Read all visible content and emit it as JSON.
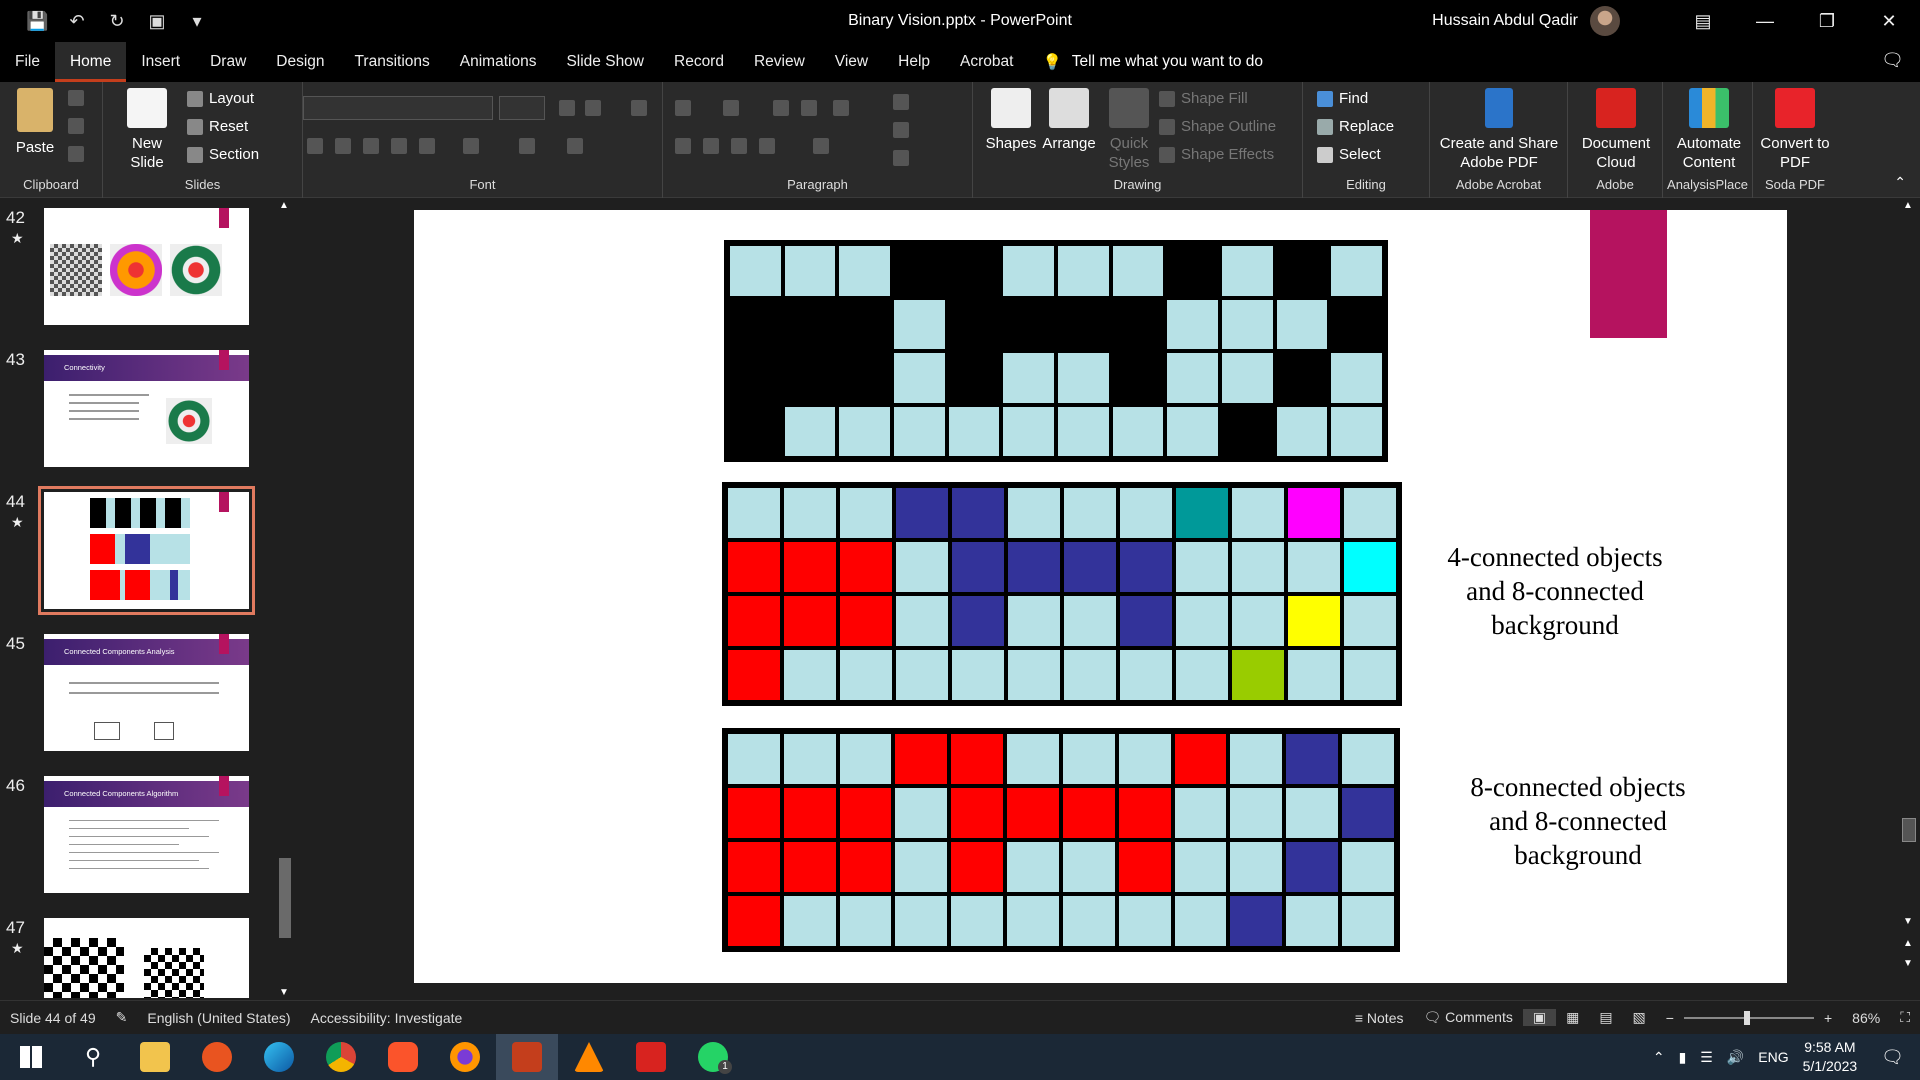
{
  "window": {
    "title": "Binary Vision.pptx  -  PowerPoint",
    "user": "Hussain Abdul Qadir"
  },
  "tabs": [
    "File",
    "Home",
    "Insert",
    "Draw",
    "Design",
    "Transitions",
    "Animations",
    "Slide Show",
    "Record",
    "Review",
    "View",
    "Help",
    "Acrobat"
  ],
  "tellme": "Tell me what you want to do",
  "ribbon": {
    "clipboard": {
      "paste": "Paste",
      "label": "Clipboard"
    },
    "slides": {
      "new_slide": "New Slide",
      "layout": "Layout",
      "reset": "Reset",
      "section": "Section",
      "label": "Slides"
    },
    "font": {
      "label": "Font"
    },
    "paragraph": {
      "label": "Paragraph"
    },
    "drawing": {
      "shapes": "Shapes",
      "arrange": "Arrange",
      "quick_styles": "Quick Styles",
      "shape_fill": "Shape Fill",
      "shape_outline": "Shape Outline",
      "shape_effects": "Shape Effects",
      "label": "Drawing"
    },
    "editing": {
      "find": "Find",
      "replace": "Replace",
      "select": "Select",
      "label": "Editing"
    },
    "acrobat": {
      "create": "Create and Share Adobe PDF",
      "label": "Adobe Acrobat"
    },
    "adobe": {
      "doc_cloud": "Document Cloud",
      "label": "Adobe"
    },
    "analysis": {
      "automate": "Automate Content",
      "label": "AnalysisPlace"
    },
    "soda": {
      "convert": "Convert to PDF",
      "label": "Soda PDF"
    }
  },
  "thumbnails": [
    {
      "num": "42",
      "star": true,
      "title": ""
    },
    {
      "num": "43",
      "star": false,
      "title": "Connectivity"
    },
    {
      "num": "44",
      "star": true,
      "title": ""
    },
    {
      "num": "45",
      "star": false,
      "title": "Connected Components Analysis"
    },
    {
      "num": "46",
      "star": false,
      "title": "Connected Components Algorithm"
    },
    {
      "num": "47",
      "star": true,
      "title": ""
    }
  ],
  "slide": {
    "caption1": "4-connected objects and 8-connected background",
    "caption2": "8-connected objects and 8-connected background",
    "grid1": [
      "LLLBBLLLBLBL",
      "BBBLBBBBLLLB",
      "BBBLBLLBLLBL",
      "BLLLLLLLLBLL"
    ],
    "grid2": [
      "LLLNNLLLTLML",
      "RRRLNNNNLLLC",
      "RRRLNLLNLLYL",
      "RLLLLLLLLGLL"
    ],
    "grid3": [
      "LLLRRLLLRLNL",
      "RRRLRRRRLLLN",
      "RRRLRLLRLLNL",
      "RLLLLLLLLNLL"
    ],
    "colors": {
      "L": "#b7e1e6",
      "B": "#000000",
      "N": "#33339a",
      "R": "#ff0000",
      "T": "#009999",
      "M": "#ff00ff",
      "C": "#00ffff",
      "Y": "#ffff00",
      "G": "#99cc00"
    }
  },
  "status": {
    "slide": "Slide 44 of 49",
    "language": "English (United States)",
    "accessibility": "Accessibility: Investigate",
    "notes": "Notes",
    "comments": "Comments",
    "zoom": "86%"
  },
  "taskbar": {
    "lang": "ENG",
    "time": "9:58 AM",
    "date": "5/1/2023",
    "whatsapp_badge": "1"
  }
}
